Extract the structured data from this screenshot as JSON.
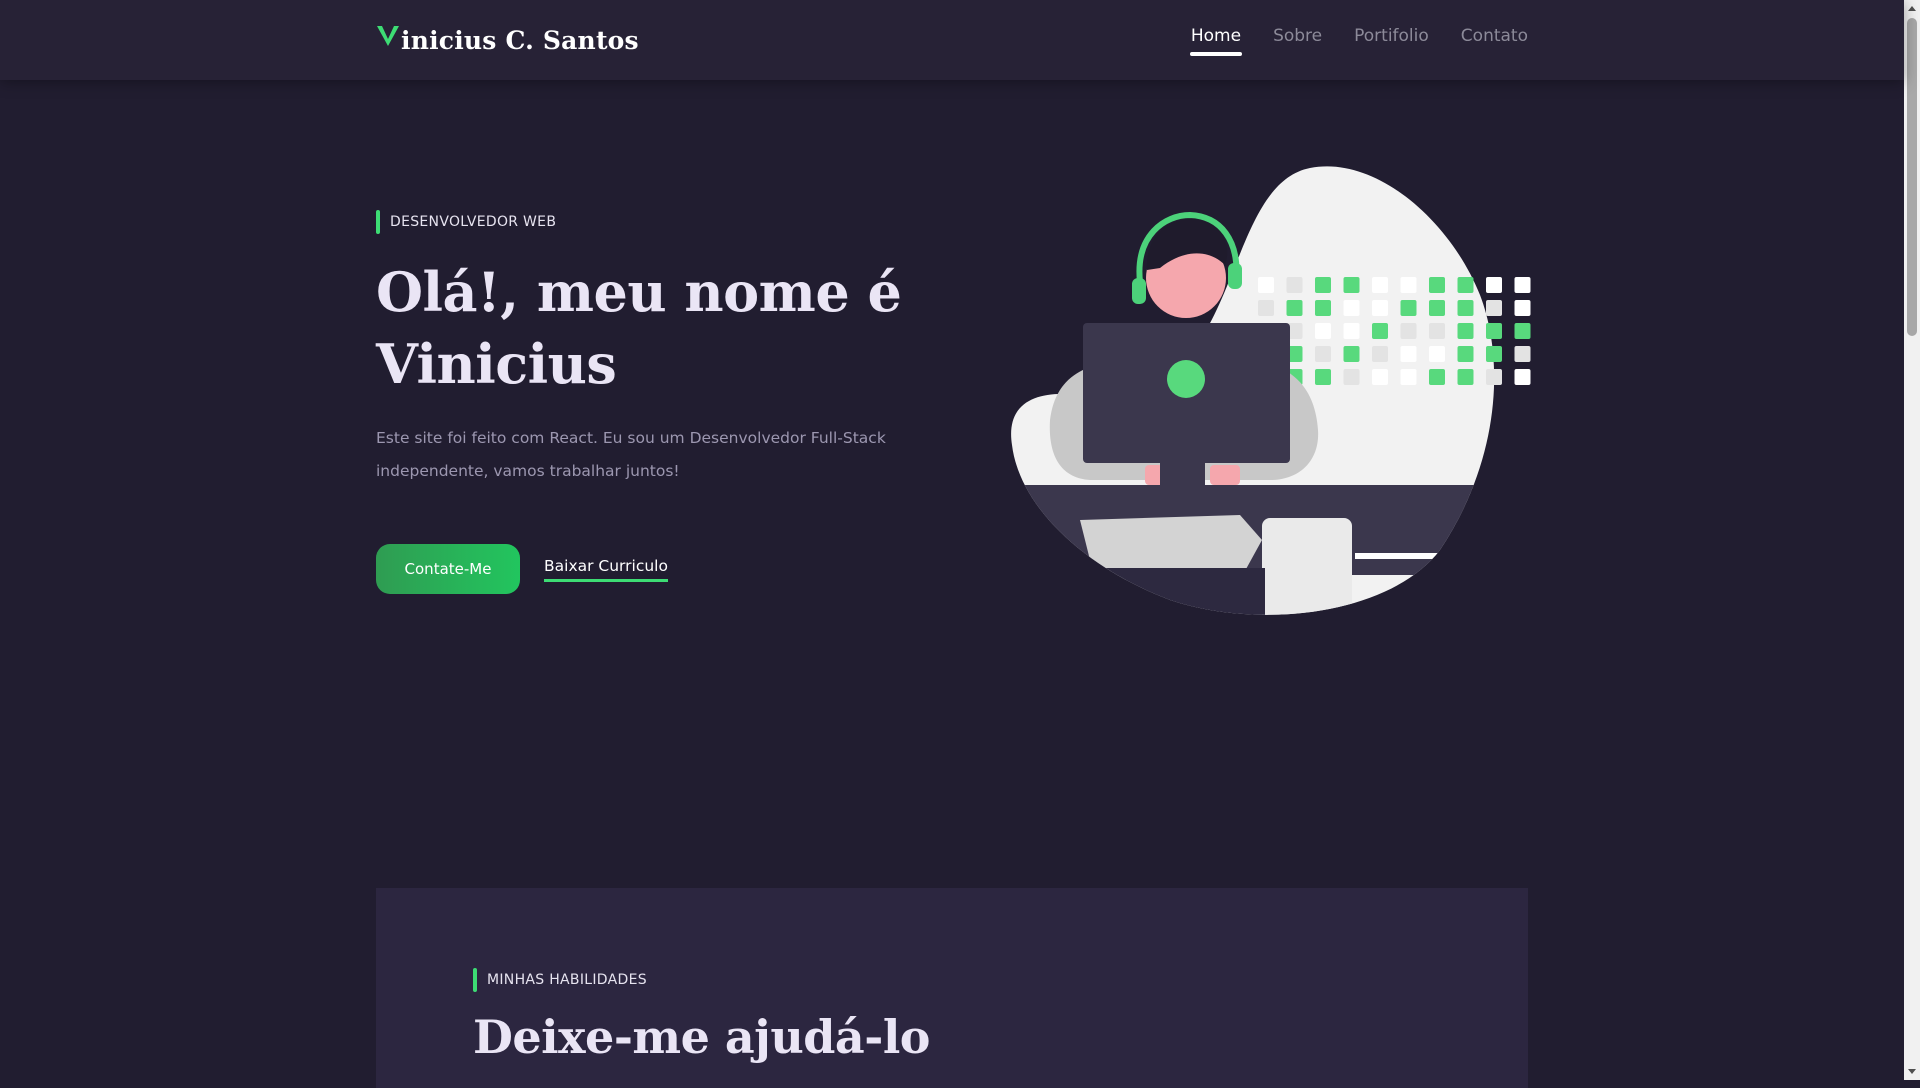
{
  "header": {
    "brand_initial": "V",
    "brand_rest": "inicius C. Santos",
    "nav": [
      {
        "label": "Home",
        "active": true
      },
      {
        "label": "Sobre",
        "active": false
      },
      {
        "label": "Portifolio",
        "active": false
      },
      {
        "label": "Contato",
        "active": false
      }
    ]
  },
  "hero": {
    "eyebrow": "DESENVOLVEDOR WEB",
    "title_line1": "Olá!, meu nome é",
    "title_line2": "Vinicius",
    "subtitle": "Este site foi feito com React. Eu sou um Desenvolvedor Full-Stack independente, vamos trabalhar juntos!",
    "primary_button": "Contate-Me",
    "secondary_link": "Baixar Curriculo",
    "illustration_icon": "developer-at-computer-illustration"
  },
  "skills": {
    "eyebrow": "MINHAS HABILIDADES",
    "title": "Deixe-me ajudá-lo"
  },
  "colors": {
    "background": "#211d30",
    "navbar": "#272236",
    "accent_green": "#3ddc74",
    "section_panel": "#2c2640",
    "title_text": "#eae5f5",
    "muted_text": "#9c97b0"
  }
}
